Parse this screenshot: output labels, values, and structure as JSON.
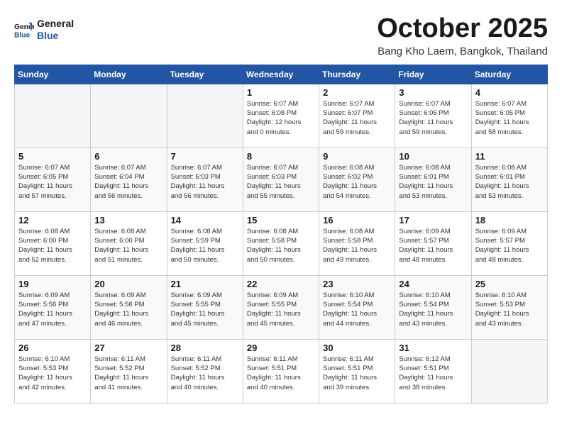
{
  "header": {
    "logo_line1": "General",
    "logo_line2": "Blue",
    "title": "October 2025",
    "subtitle": "Bang Kho Laem, Bangkok, Thailand"
  },
  "days_of_week": [
    "Sunday",
    "Monday",
    "Tuesday",
    "Wednesday",
    "Thursday",
    "Friday",
    "Saturday"
  ],
  "weeks": [
    {
      "days": [
        {
          "num": "",
          "info": ""
        },
        {
          "num": "",
          "info": ""
        },
        {
          "num": "",
          "info": ""
        },
        {
          "num": "1",
          "info": "Sunrise: 6:07 AM\nSunset: 6:08 PM\nDaylight: 12 hours\nand 0 minutes."
        },
        {
          "num": "2",
          "info": "Sunrise: 6:07 AM\nSunset: 6:07 PM\nDaylight: 11 hours\nand 59 minutes."
        },
        {
          "num": "3",
          "info": "Sunrise: 6:07 AM\nSunset: 6:06 PM\nDaylight: 11 hours\nand 59 minutes."
        },
        {
          "num": "4",
          "info": "Sunrise: 6:07 AM\nSunset: 6:05 PM\nDaylight: 11 hours\nand 58 minutes."
        }
      ]
    },
    {
      "days": [
        {
          "num": "5",
          "info": "Sunrise: 6:07 AM\nSunset: 6:05 PM\nDaylight: 11 hours\nand 57 minutes."
        },
        {
          "num": "6",
          "info": "Sunrise: 6:07 AM\nSunset: 6:04 PM\nDaylight: 11 hours\nand 56 minutes."
        },
        {
          "num": "7",
          "info": "Sunrise: 6:07 AM\nSunset: 6:03 PM\nDaylight: 11 hours\nand 56 minutes."
        },
        {
          "num": "8",
          "info": "Sunrise: 6:07 AM\nSunset: 6:03 PM\nDaylight: 11 hours\nand 55 minutes."
        },
        {
          "num": "9",
          "info": "Sunrise: 6:08 AM\nSunset: 6:02 PM\nDaylight: 11 hours\nand 54 minutes."
        },
        {
          "num": "10",
          "info": "Sunrise: 6:08 AM\nSunset: 6:01 PM\nDaylight: 11 hours\nand 53 minutes."
        },
        {
          "num": "11",
          "info": "Sunrise: 6:08 AM\nSunset: 6:01 PM\nDaylight: 11 hours\nand 53 minutes."
        }
      ]
    },
    {
      "days": [
        {
          "num": "12",
          "info": "Sunrise: 6:08 AM\nSunset: 6:00 PM\nDaylight: 11 hours\nand 52 minutes."
        },
        {
          "num": "13",
          "info": "Sunrise: 6:08 AM\nSunset: 6:00 PM\nDaylight: 11 hours\nand 51 minutes."
        },
        {
          "num": "14",
          "info": "Sunrise: 6:08 AM\nSunset: 5:59 PM\nDaylight: 11 hours\nand 50 minutes."
        },
        {
          "num": "15",
          "info": "Sunrise: 6:08 AM\nSunset: 5:58 PM\nDaylight: 11 hours\nand 50 minutes."
        },
        {
          "num": "16",
          "info": "Sunrise: 6:08 AM\nSunset: 5:58 PM\nDaylight: 11 hours\nand 49 minutes."
        },
        {
          "num": "17",
          "info": "Sunrise: 6:09 AM\nSunset: 5:57 PM\nDaylight: 11 hours\nand 48 minutes."
        },
        {
          "num": "18",
          "info": "Sunrise: 6:09 AM\nSunset: 5:57 PM\nDaylight: 11 hours\nand 48 minutes."
        }
      ]
    },
    {
      "days": [
        {
          "num": "19",
          "info": "Sunrise: 6:09 AM\nSunset: 5:56 PM\nDaylight: 11 hours\nand 47 minutes."
        },
        {
          "num": "20",
          "info": "Sunrise: 6:09 AM\nSunset: 5:56 PM\nDaylight: 11 hours\nand 46 minutes."
        },
        {
          "num": "21",
          "info": "Sunrise: 6:09 AM\nSunset: 5:55 PM\nDaylight: 11 hours\nand 45 minutes."
        },
        {
          "num": "22",
          "info": "Sunrise: 6:09 AM\nSunset: 5:55 PM\nDaylight: 11 hours\nand 45 minutes."
        },
        {
          "num": "23",
          "info": "Sunrise: 6:10 AM\nSunset: 5:54 PM\nDaylight: 11 hours\nand 44 minutes."
        },
        {
          "num": "24",
          "info": "Sunrise: 6:10 AM\nSunset: 5:54 PM\nDaylight: 11 hours\nand 43 minutes."
        },
        {
          "num": "25",
          "info": "Sunrise: 6:10 AM\nSunset: 5:53 PM\nDaylight: 11 hours\nand 43 minutes."
        }
      ]
    },
    {
      "days": [
        {
          "num": "26",
          "info": "Sunrise: 6:10 AM\nSunset: 5:53 PM\nDaylight: 11 hours\nand 42 minutes."
        },
        {
          "num": "27",
          "info": "Sunrise: 6:11 AM\nSunset: 5:52 PM\nDaylight: 11 hours\nand 41 minutes."
        },
        {
          "num": "28",
          "info": "Sunrise: 6:11 AM\nSunset: 5:52 PM\nDaylight: 11 hours\nand 40 minutes."
        },
        {
          "num": "29",
          "info": "Sunrise: 6:11 AM\nSunset: 5:51 PM\nDaylight: 11 hours\nand 40 minutes."
        },
        {
          "num": "30",
          "info": "Sunrise: 6:11 AM\nSunset: 5:51 PM\nDaylight: 11 hours\nand 39 minutes."
        },
        {
          "num": "31",
          "info": "Sunrise: 6:12 AM\nSunset: 5:51 PM\nDaylight: 11 hours\nand 38 minutes."
        },
        {
          "num": "",
          "info": ""
        }
      ]
    }
  ]
}
